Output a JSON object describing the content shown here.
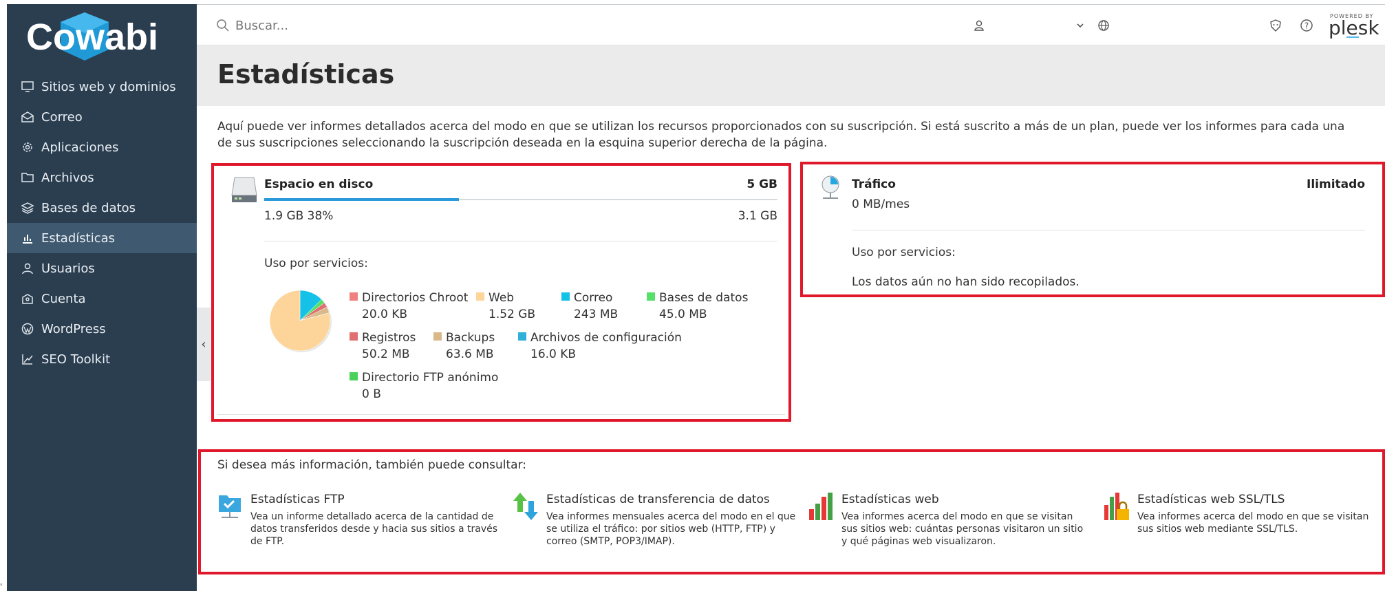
{
  "sidebar": {
    "logo_text": "Cowabi",
    "items": [
      {
        "label": "Sitios web y dominios",
        "icon": "monitor-icon"
      },
      {
        "label": "Correo",
        "icon": "envelope-icon"
      },
      {
        "label": "Aplicaciones",
        "icon": "gear-icon"
      },
      {
        "label": "Archivos",
        "icon": "folder-icon"
      },
      {
        "label": "Bases de datos",
        "icon": "layers-icon"
      },
      {
        "label": "Estadísticas",
        "icon": "bar-chart-icon",
        "active": true
      },
      {
        "label": "Usuarios",
        "icon": "user-icon"
      },
      {
        "label": "Cuenta",
        "icon": "account-icon"
      },
      {
        "label": "WordPress",
        "icon": "wordpress-icon"
      },
      {
        "label": "SEO Toolkit",
        "icon": "seo-chart-icon"
      }
    ]
  },
  "topbar": {
    "search_placeholder": "Buscar...",
    "powered_by": "POWERED BY",
    "brand": "plesk"
  },
  "page": {
    "title": "Estadísticas",
    "intro": "Aquí puede ver informes detallados acerca del modo en que se utilizan los recursos proporcionados con su suscripción. Si está suscrito a más de un plan, puede ver los informes para cada una de sus suscripciones seleccionando la suscripción deseada en la esquina superior derecha de la página."
  },
  "disk": {
    "title": "Espacio en disco",
    "total": "5 GB",
    "used": "1.9 GB 38%",
    "free": "3.1 GB",
    "used_fraction": 0.38,
    "services_label": "Uso por servicios:",
    "legend": [
      {
        "name": "Directorios Chroot",
        "value": "20.0 KB",
        "color": "#f08080"
      },
      {
        "name": "Web",
        "value": "1.52 GB",
        "color": "#fdd59a"
      },
      {
        "name": "Correo",
        "value": "243 MB",
        "color": "#16c1e8"
      },
      {
        "name": "Bases de datos",
        "value": "45.0 MB",
        "color": "#56e06a"
      },
      {
        "name": "Registros",
        "value": "50.2 MB",
        "color": "#e07070"
      },
      {
        "name": "Backups",
        "value": "63.6 MB",
        "color": "#d9b98a"
      },
      {
        "name": "Archivos de configuración",
        "value": "16.0 KB",
        "color": "#2fb0d8"
      },
      {
        "name": "Directorio FTP anónimo",
        "value": "0 B",
        "color": "#49d15a"
      }
    ]
  },
  "chart_data": {
    "type": "pie",
    "categories": [
      "Directorios Chroot",
      "Web",
      "Correo",
      "Bases de datos",
      "Registros",
      "Backups",
      "Archivos de configuración",
      "Directorio FTP anónimo"
    ],
    "values": [
      2e-05,
      1.52,
      0.243,
      0.045,
      0.0502,
      0.0636,
      1.6e-05,
      0
    ],
    "unit": "GB"
  },
  "traffic": {
    "title": "Tráfico",
    "limit": "Ilimitado",
    "usage": "0 MB/mes",
    "services_label": "Uso por servicios:",
    "empty_message": "Los datos aún no han sido recopilados."
  },
  "more_info": {
    "label": "Si desea más información, también puede consultar:",
    "links": [
      {
        "title": "Estadísticas FTP",
        "desc": "Vea un informe detallado acerca de la cantidad de datos transferidos desde y hacia sus sitios a través de FTP.",
        "icon": "ftp-folder-icon"
      },
      {
        "title": "Estadísticas de transferencia de datos",
        "desc": "Vea informes mensuales acerca del modo en el que se utiliza el tráfico: por sitios web (HTTP, FTP) y correo (SMTP, POP3/IMAP).",
        "icon": "transfer-arrows-icon"
      },
      {
        "title": "Estadísticas web",
        "desc": "Vea informes acerca del modo en que se visitan sus sitios web: cuántas personas visitaron un sitio y qué páginas web visualizaron.",
        "icon": "web-stats-icon"
      },
      {
        "title": "Estadísticas web SSL/TLS",
        "desc": "Vea informes acerca del modo en que se visitan sus sitios web mediante SSL/TLS.",
        "icon": "ssl-stats-icon"
      }
    ]
  }
}
